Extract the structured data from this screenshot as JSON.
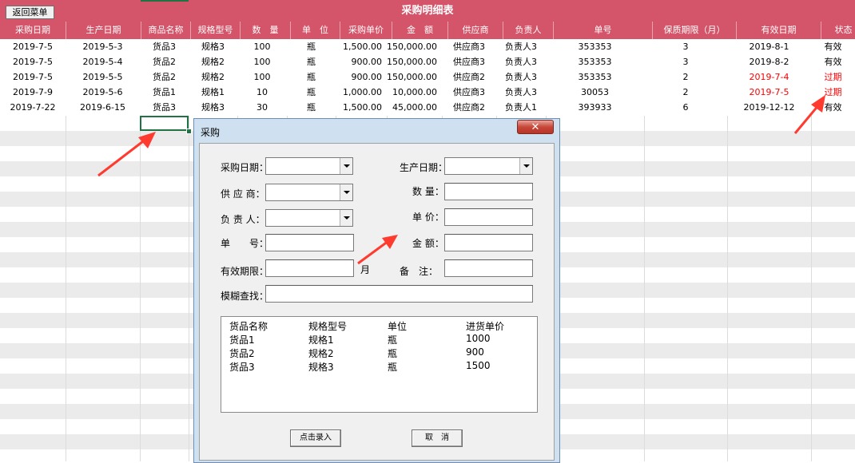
{
  "sheet": {
    "title": "采购明细表",
    "back_button": "返回菜单",
    "accent_color": "#d4546a",
    "columns": [
      "采购日期",
      "生产日期",
      "商品名称",
      "规格型号",
      "数　量",
      "单　位",
      "采购单价",
      "金　额",
      "供应商",
      "负责人",
      "单号",
      "保质期限（月）",
      "有效日期",
      "状态"
    ],
    "rows": [
      [
        "2019-7-5",
        "2019-5-3",
        "货品3",
        "规格3",
        "100",
        "瓶",
        "1,500.00",
        "150,000.00",
        "供应商3",
        "负责人3",
        "353353",
        "3",
        "2019-8-1",
        "有效"
      ],
      [
        "2019-7-5",
        "2019-5-4",
        "货品2",
        "规格2",
        "100",
        "瓶",
        "900.00",
        "150,000.00",
        "供应商3",
        "负责人3",
        "353353",
        "3",
        "2019-8-2",
        "有效"
      ],
      [
        "2019-7-5",
        "2019-5-5",
        "货品2",
        "规格2",
        "100",
        "瓶",
        "900.00",
        "150,000.00",
        "供应商2",
        "负责人3",
        "353353",
        "2",
        "2019-7-4",
        "过期"
      ],
      [
        "2019-7-9",
        "2019-5-6",
        "货品1",
        "规格1",
        "10",
        "瓶",
        "1,000.00",
        "10,000.00",
        "供应商3",
        "负责人3",
        "30053",
        "2",
        "2019-7-5",
        "过期"
      ],
      [
        "2019-7-22",
        "2019-6-15",
        "货品3",
        "规格3",
        "30",
        "瓶",
        "1,500.00",
        "45,000.00",
        "供应商2",
        "负责人1",
        "393933",
        "6",
        "2019-12-12",
        "有效"
      ]
    ],
    "expired_flags": [
      false,
      false,
      true,
      true,
      false
    ]
  },
  "dialog": {
    "title": "采购",
    "close_symbol": "✕",
    "labels": {
      "purchase_date": "采购日期：",
      "production_date": "生产日期：",
      "supplier": "供 应 商：",
      "quantity": "数 量：",
      "manager": "负 责 人：",
      "unit_price": "单 价：",
      "order_no": "单　　号：",
      "amount": "金 额：",
      "validity": "有效期限：",
      "validity_unit": "月",
      "remark": "备　注：",
      "fuzzy_search": "模糊查找："
    },
    "fields": {
      "purchase_date": "",
      "production_date": "",
      "supplier": "",
      "quantity": "",
      "manager": "",
      "unit_price": "",
      "order_no": "",
      "amount": "",
      "validity": "",
      "remark": "",
      "fuzzy_search": ""
    },
    "list": {
      "headers": [
        "货品名称",
        "规格型号",
        "单位",
        "进货单价"
      ],
      "rows": [
        [
          "货品1",
          "规格1",
          "瓶",
          "1000"
        ],
        [
          "货品2",
          "规格2",
          "瓶",
          "900"
        ],
        [
          "货品3",
          "规格3",
          "瓶",
          "1500"
        ]
      ]
    },
    "buttons": {
      "submit": "点击录入",
      "cancel": "取　消"
    }
  }
}
